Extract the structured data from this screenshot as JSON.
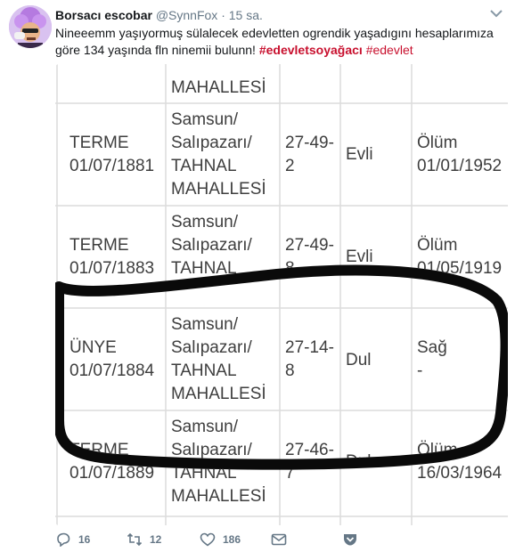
{
  "tweet": {
    "name": "Borsacı escobar",
    "handle": "@SynnFox",
    "separator": "·",
    "time": "15 sa.",
    "text_line1": "Nineeemm yaşıyormuş sülalecek edevletten ogrendik yaşadıgını hesaplarımıza",
    "text_line2": "göre 134 yaşında fln ninemii bulunn!",
    "hashtags": [
      "#edevletsoyağacı",
      "#edevlet"
    ],
    "actions": {
      "replies": "16",
      "retweets": "12",
      "likes": "186"
    }
  },
  "table": {
    "rows": [
      {
        "place": "",
        "date": "",
        "address": [
          "",
          "",
          "MAHALLESİ"
        ],
        "cilt": [
          "",
          ""
        ],
        "status": "",
        "life": [
          "",
          ""
        ]
      },
      {
        "place": "TERME",
        "date": "01/07/1881",
        "address": [
          "Samsun/",
          "Salıpazarı/",
          "TAHNAL",
          "MAHALLESİ"
        ],
        "cilt": [
          "27-49-",
          "2"
        ],
        "status": "Evli",
        "life": [
          "Ölüm",
          "01/01/1952"
        ]
      },
      {
        "place": "TERME",
        "date": "01/07/1883",
        "address": [
          "Samsun/",
          "Salıpazarı/",
          "TAHNAL"
        ],
        "cilt": [
          "27-49-",
          "8"
        ],
        "status": "Evli",
        "life": [
          "Ölüm",
          "01/05/1919"
        ]
      },
      {
        "place": "ÜNYE",
        "date": "01/07/1884",
        "address": [
          "Samsun/",
          "Salıpazarı/",
          "TAHNAL",
          "MAHALLESİ"
        ],
        "cilt": [
          "27-14-",
          "8"
        ],
        "status": "Dul",
        "life": [
          "Sağ",
          "-"
        ]
      },
      {
        "place": "TERME",
        "date": "01/07/1889",
        "address": [
          "Samsun/",
          "Salıpazarı/",
          "TAHNAL",
          "MAHALLESİ"
        ],
        "cilt": [
          "27-46-",
          "7"
        ],
        "status": "Dul",
        "life": [
          "Ölüm",
          "16/03/1964"
        ]
      }
    ]
  },
  "colors": {
    "hashtag": "#c8102e",
    "meta": "#657786",
    "table_text": "#3e3e3e",
    "grid": "#dcdcdc",
    "marker": "#0a0a0a"
  }
}
